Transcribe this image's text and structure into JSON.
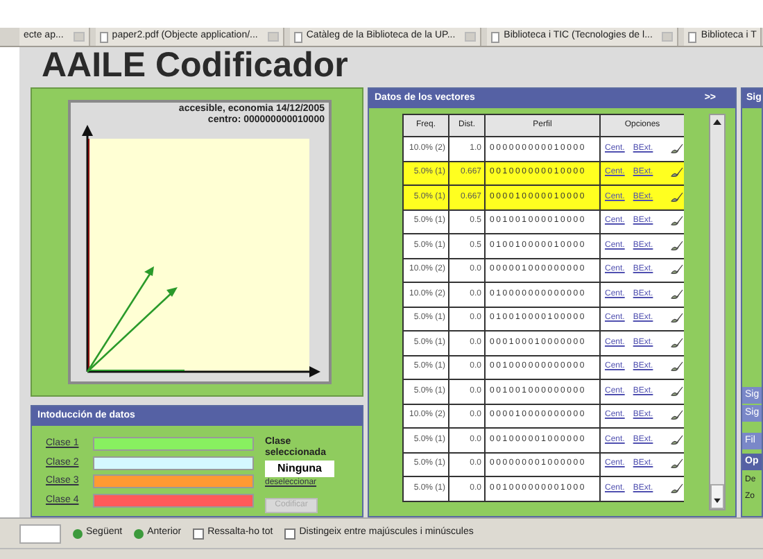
{
  "tabs": [
    {
      "label": "ecte ap...",
      "icon": false
    },
    {
      "label": "paper2.pdf (Objecte application/...",
      "icon": true
    },
    {
      "label": "Catàleg de la Biblioteca de la UP...",
      "icon": true
    },
    {
      "label": "Biblioteca i TIC (Tecnologies de l...",
      "icon": true
    },
    {
      "label": "Biblioteca i T",
      "icon": true,
      "close_hidden": true
    }
  ],
  "page_title": "AAILE Codificador",
  "chart": {
    "caption": "accesible, economia 14/12/2005",
    "center": "centro: 000000000010000"
  },
  "vectors": {
    "title": "Datos de los vectores",
    "expand": ">>",
    "columns": [
      "Freq.",
      "Dist.",
      "Perfil",
      "Opciones"
    ],
    "rows": [
      {
        "freq": "10.0% (2)",
        "dist": "1.0",
        "profile": "000000000010000",
        "highlighted": false
      },
      {
        "freq": "5.0% (1)",
        "dist": "0.667",
        "profile": "001000000010000",
        "highlighted": true
      },
      {
        "freq": "5.0% (1)",
        "dist": "0.667",
        "profile": "000010000010000",
        "highlighted": true
      },
      {
        "freq": "5.0% (1)",
        "dist": "0.5",
        "profile": "001001000010000",
        "highlighted": false
      },
      {
        "freq": "5.0% (1)",
        "dist": "0.5",
        "profile": "010010000010000",
        "highlighted": false
      },
      {
        "freq": "10.0% (2)",
        "dist": "0.0",
        "profile": "000001000000000",
        "highlighted": false
      },
      {
        "freq": "10.0% (2)",
        "dist": "0.0",
        "profile": "010000000000000",
        "highlighted": false
      },
      {
        "freq": "5.0% (1)",
        "dist": "0.0",
        "profile": "010010000100000",
        "highlighted": false
      },
      {
        "freq": "5.0% (1)",
        "dist": "0.0",
        "profile": "000100010000000",
        "highlighted": false
      },
      {
        "freq": "5.0% (1)",
        "dist": "0.0",
        "profile": "001000000000000",
        "highlighted": false
      },
      {
        "freq": "5.0% (1)",
        "dist": "0.0",
        "profile": "001001000000000",
        "highlighted": false
      },
      {
        "freq": "10.0% (2)",
        "dist": "0.0",
        "profile": "000010000000000",
        "highlighted": false
      },
      {
        "freq": "5.0% (1)",
        "dist": "0.0",
        "profile": "001000001000000",
        "highlighted": false
      },
      {
        "freq": "5.0% (1)",
        "dist": "0.0",
        "profile": "000000001000000",
        "highlighted": false
      },
      {
        "freq": "5.0% (1)",
        "dist": "0.0",
        "profile": "001000000001000",
        "highlighted": false
      }
    ],
    "links": [
      [
        "Cent.",
        "BExt."
      ],
      [
        "Cent.",
        "BExt."
      ],
      [
        "Cent.",
        "BExt."
      ],
      [
        "Cent.",
        "BExt."
      ],
      [
        "Cent.",
        "BExt."
      ],
      [
        "Cent.",
        "BExt."
      ],
      [
        "Cent.",
        "BExt."
      ],
      [
        "Cent.",
        "BExt."
      ],
      [
        "Cent.",
        "BExt."
      ],
      [
        "Cent.",
        "BExt."
      ],
      [
        "Cent.",
        "BExt."
      ],
      [
        "Cent.",
        "BExt."
      ],
      [
        "Cent.",
        "BExt."
      ],
      [
        "Cent.",
        "BExt."
      ],
      [
        "Cent.",
        "BExt."
      ]
    ]
  },
  "right_panel": {
    "title": "Sig",
    "buttons": [
      "Sig",
      "Sig"
    ],
    "filter": "Fil",
    "options": "Op",
    "lines": [
      "De",
      "Zo"
    ]
  },
  "input": {
    "title": "Intoducción de datos",
    "classes": [
      {
        "label": "Clase 1",
        "color": "#88f060"
      },
      {
        "label": "Clase 2",
        "color": "#d4f8ff"
      },
      {
        "label": "Clase 3",
        "color": "#ff9a33"
      },
      {
        "label": "Clase 4",
        "color": "#ff5a5a"
      }
    ],
    "selected_label": "Clase seleccionada",
    "selected_value": "Ninguna",
    "deselect": "deseleccionar",
    "encode": {
      "label": "Codificar",
      "disabled": true
    }
  },
  "find_bar": {
    "next": "Següent",
    "previous": "Anterior",
    "options": [
      {
        "label": "Ressalta-ho tot",
        "checked": false
      },
      {
        "label": "Distingeix entre majúscules i minúscules",
        "checked": false
      }
    ]
  }
}
